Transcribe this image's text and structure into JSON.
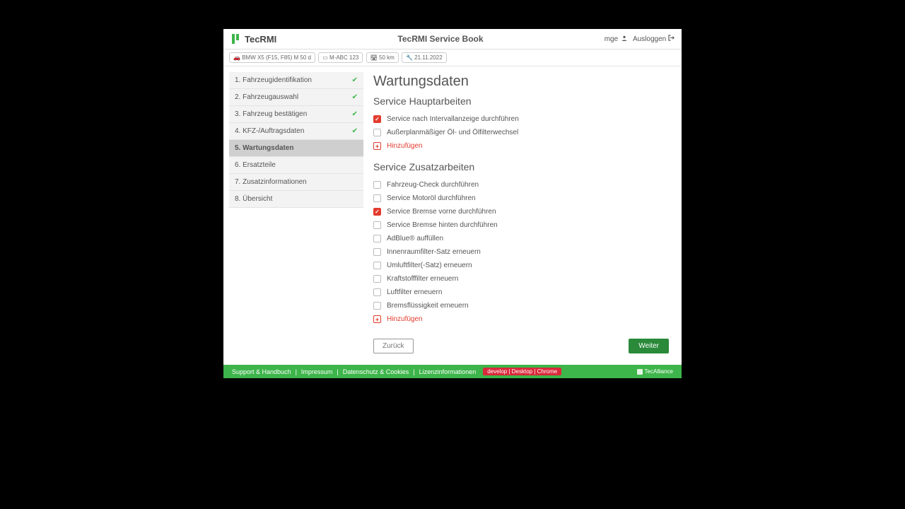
{
  "header": {
    "brand": "TecRMI",
    "title": "TecRMI Service Book",
    "user": "mge",
    "logout": "Ausloggen"
  },
  "pills": {
    "vehicle": "BMW X5 (F15, F85) M 50 d",
    "plate": "M-ABC 123",
    "km": "50 km",
    "date": "21.11.2022"
  },
  "steps": [
    {
      "label": "1. Fahrzeugidentifikation",
      "done": true,
      "active": false
    },
    {
      "label": "2. Fahrzeugauswahl",
      "done": true,
      "active": false
    },
    {
      "label": "3. Fahrzeug bestätigen",
      "done": true,
      "active": false
    },
    {
      "label": "4. KFZ-/Auftragsdaten",
      "done": true,
      "active": false
    },
    {
      "label": "5. Wartungsdaten",
      "done": false,
      "active": true
    },
    {
      "label": "6. Ersatzteile",
      "done": false,
      "active": false
    },
    {
      "label": "7. Zusatzinformationen",
      "done": false,
      "active": false
    },
    {
      "label": "8. Übersicht",
      "done": false,
      "active": false
    }
  ],
  "page": {
    "title": "Wartungsdaten",
    "section1": "Service Hauptarbeiten",
    "section2": "Service Zusatzarbeiten",
    "add": "Hinzufügen",
    "back": "Zurück",
    "next": "Weiter"
  },
  "mainItems": [
    {
      "label": "Service nach Intervallanzeige durchführen",
      "checked": true
    },
    {
      "label": "Außerplanmäßiger Öl- und Ölfilterwechsel",
      "checked": false
    }
  ],
  "extraItems": [
    {
      "label": "Fahrzeug-Check durchführen",
      "checked": false
    },
    {
      "label": "Service Motoröl durchführen",
      "checked": false
    },
    {
      "label": "Service Bremse vorne durchführen",
      "checked": true
    },
    {
      "label": "Service Bremse hinten durchführen",
      "checked": false
    },
    {
      "label": "AdBlue® auffüllen",
      "checked": false
    },
    {
      "label": "Innenraumfilter-Satz erneuern",
      "checked": false
    },
    {
      "label": "Umluftfilter(-Satz) erneuern",
      "checked": false
    },
    {
      "label": "Kraftstofffilter erneuern",
      "checked": false
    },
    {
      "label": "Luftfilter erneuern",
      "checked": false
    },
    {
      "label": "Bremsflüssigkeit erneuern",
      "checked": false
    }
  ],
  "footer": {
    "links": [
      "Support & Handbuch",
      "Impressum",
      "Datenschutz & Cookies",
      "Lizenzinformationen"
    ],
    "tag": "develop | Desktop | Chrome",
    "brand": "TecAlliance"
  }
}
